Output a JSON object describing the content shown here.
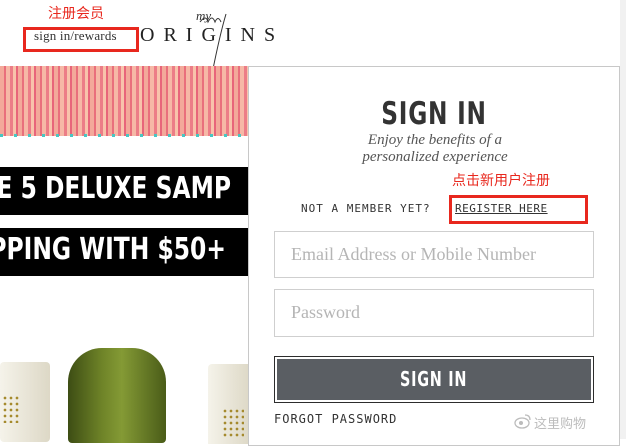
{
  "annotations": {
    "register_member": "注册会员",
    "register_here_note": "点击新用户注册"
  },
  "header": {
    "sign_in_rewards": "sign in/rewards",
    "logo": "ORIGINS",
    "logo_script": "my"
  },
  "banner": {
    "line1": "E 5 DELUXE SAMP",
    "line2": "PPING WITH $50+"
  },
  "signin_panel": {
    "title": "SIGN IN",
    "subtitle_line1": "Enjoy the benefits of a",
    "subtitle_line2": "personalized experience",
    "not_member": "NOT A MEMBER YET?",
    "register_link": "REGISTER HERE",
    "email_placeholder": "Email Address or Mobile Number",
    "password_placeholder": "Password",
    "signin_button": "SIGN IN",
    "forgot_password": "FORGOT PASSWORD"
  },
  "watermark": "这里购物",
  "colors": {
    "annotation_red": "#e8281e",
    "button_gray": "#5a5e63"
  }
}
